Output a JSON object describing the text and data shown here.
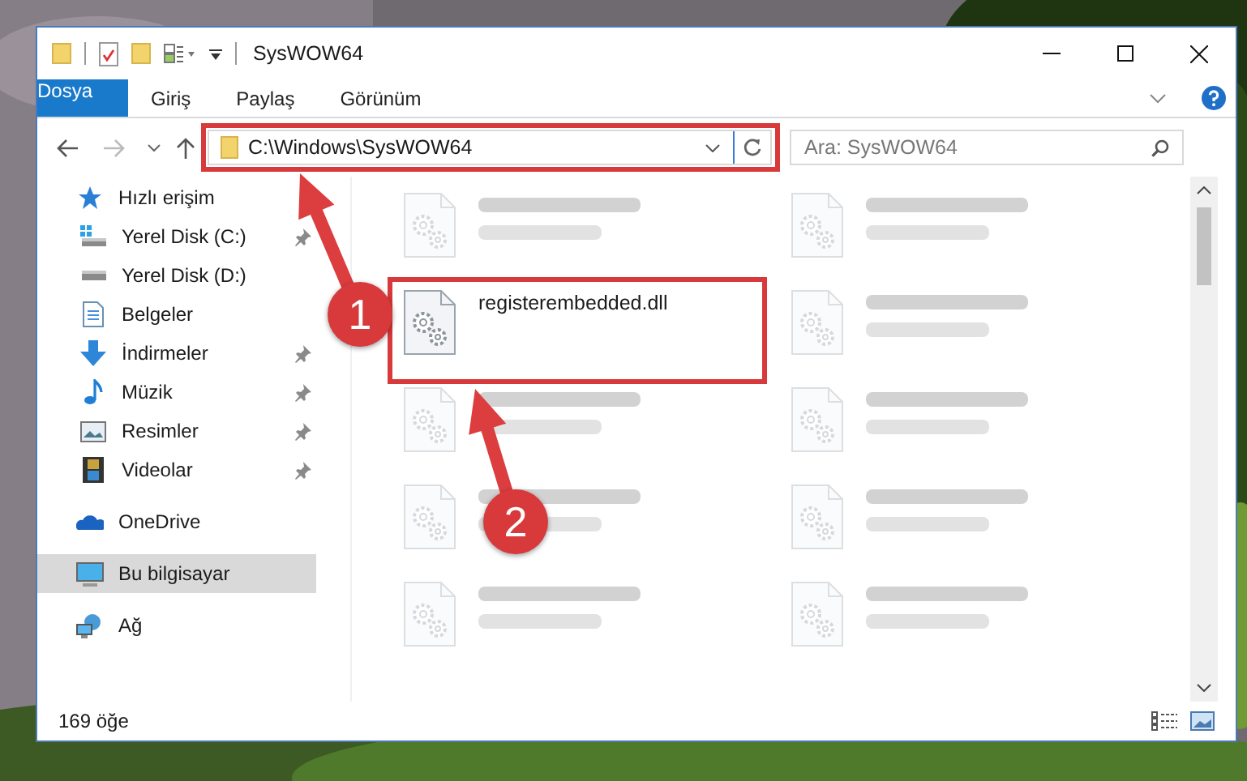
{
  "window": {
    "title": "SysWOW64"
  },
  "ribbon_tabs": [
    {
      "label": "Dosya",
      "kind": "file"
    },
    {
      "label": "Giriş",
      "kind": "tab"
    },
    {
      "label": "Paylaş",
      "kind": "tab"
    },
    {
      "label": "Görünüm",
      "kind": "tab"
    }
  ],
  "address": {
    "path": "C:\\Windows\\SysWOW64"
  },
  "search": {
    "placeholder": "Ara: SysWOW64"
  },
  "nav": [
    {
      "label": "Hızlı erişim",
      "selected": false,
      "children": [
        {
          "label": "Yerel Disk (C:)",
          "pinned": true,
          "selected": false
        },
        {
          "label": "Yerel Disk (D:)",
          "pinned": false,
          "selected": false
        },
        {
          "label": "Belgeler",
          "pinned": false,
          "selected": false
        },
        {
          "label": "İndirmeler",
          "pinned": true,
          "selected": false
        },
        {
          "label": "Müzik",
          "pinned": true,
          "selected": false
        },
        {
          "label": "Resimler",
          "pinned": true,
          "selected": false
        },
        {
          "label": "Videolar",
          "pinned": true,
          "selected": false
        }
      ]
    },
    {
      "label": "OneDrive",
      "selected": false
    },
    {
      "label": "Bu bilgisayar",
      "selected": true
    },
    {
      "label": "Ağ",
      "selected": false
    }
  ],
  "files": [
    {
      "kind": "blurred"
    },
    {
      "kind": "blurred"
    },
    {
      "kind": "file",
      "name": "registerembedded.dll"
    },
    {
      "kind": "blurred"
    },
    {
      "kind": "blurred"
    },
    {
      "kind": "blurred"
    },
    {
      "kind": "blurred"
    },
    {
      "kind": "blurred"
    },
    {
      "kind": "blurred"
    },
    {
      "kind": "blurred"
    }
  ],
  "status_bar": {
    "count": "169 öğe"
  },
  "annotations": [
    {
      "label": "1"
    },
    {
      "label": "2"
    }
  ]
}
